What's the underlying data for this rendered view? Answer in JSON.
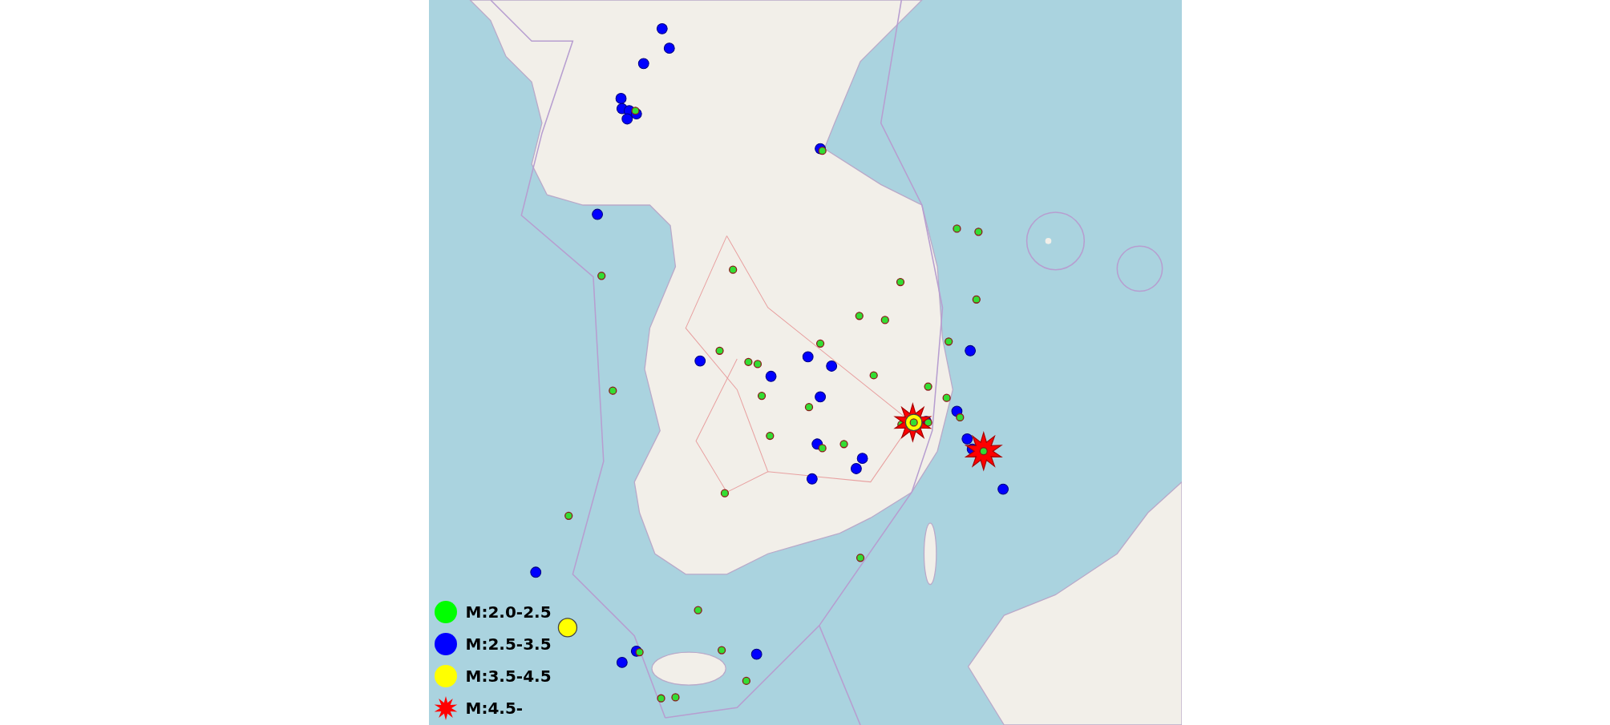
{
  "legend": [
    {
      "kind": "dot",
      "color": "#00ff00",
      "label": "M:2.0-2.5"
    },
    {
      "kind": "dot",
      "color": "#0000ff",
      "label": "M:2.5-3.5"
    },
    {
      "kind": "dot",
      "color": "#ffff00",
      "label": "M:3.5-4.5"
    },
    {
      "kind": "star",
      "color": "#ff0000",
      "label": "M:4.5-"
    }
  ]
}
